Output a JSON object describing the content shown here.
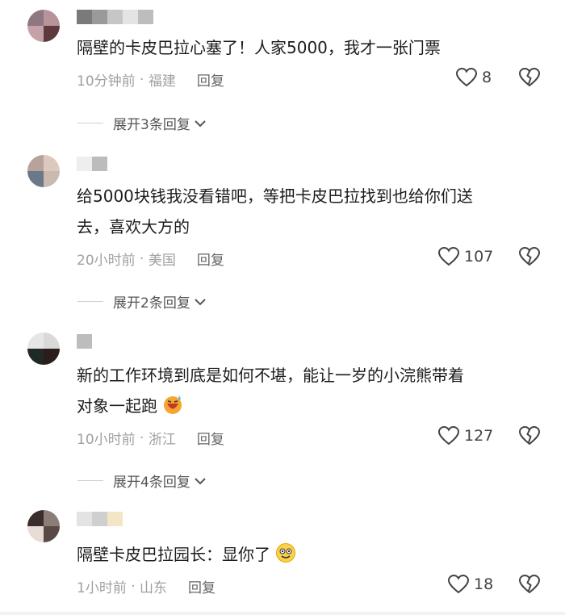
{
  "comments": [
    {
      "text": "隔壁的卡皮巴拉心塞了！人家5000，我才一张门票",
      "time": "10分钟前",
      "location": "福建",
      "reply_label": "回复",
      "likes": "8",
      "expand_label": "展开3条回复",
      "avatar_colors": [
        "#8e7682",
        "#b8949a",
        "#c4a2a8",
        "#5e3a3e"
      ],
      "name_colors": [
        "#7a7a7a",
        "#9a9a9a",
        "#c6c6c6",
        "#e4e4e4",
        "#bdbdbd"
      ]
    },
    {
      "text_line1": "给5000块钱我没看错吧，等把卡皮巴拉找到也给你们送",
      "text_line2": "去，喜欢大方的",
      "time": "20小时前",
      "location": "美国",
      "reply_label": "回复",
      "likes": "107",
      "expand_label": "展开2条回复",
      "avatar_colors": [
        "#b7a39a",
        "#ddc8c0",
        "#6a7888",
        "#c9b9ae"
      ],
      "name_colors": [
        "#eeeeee",
        "#bcbcbc"
      ]
    },
    {
      "text_line1": "新的工作环境到底是如何不堪，能让一岁的小浣熊带着",
      "text_line2": "对象一起跑",
      "time": "10小时前",
      "location": "浙江",
      "reply_label": "回复",
      "likes": "127",
      "expand_label": "展开4条回复",
      "avatar_colors": [
        "#e6e6e6",
        "#d9d9d9",
        "#1f2a24",
        "#2a1d1a"
      ],
      "name_colors": [
        "#bdbdbd"
      ]
    },
    {
      "text": "隔壁卡皮巴拉园长：显你了",
      "time": "1小时前",
      "location": "山东",
      "reply_label": "回复",
      "likes": "18",
      "avatar_colors": [
        "#3a2e2c",
        "#8b7d78",
        "#e8ddd6",
        "#5a4a46"
      ],
      "name_colors": [
        "#e3e3e3",
        "#cfcfcf",
        "#f3e6c6"
      ]
    }
  ]
}
